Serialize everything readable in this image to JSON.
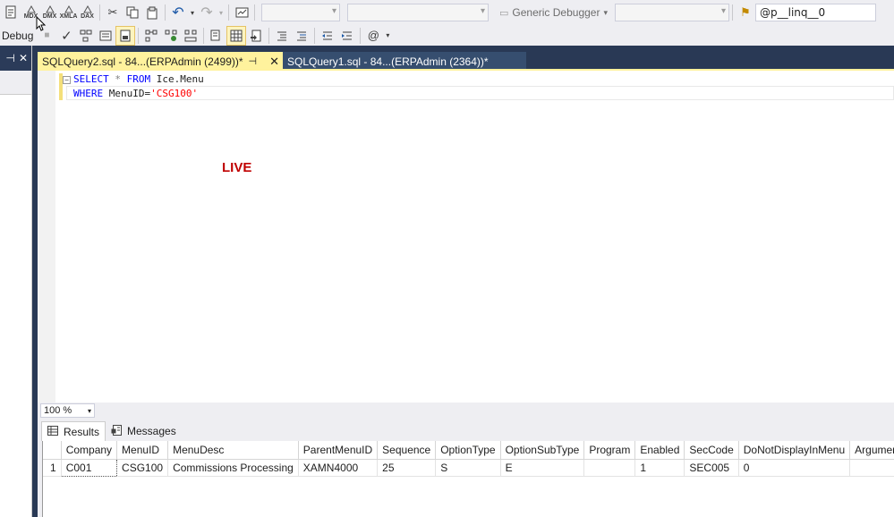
{
  "toolbar1": {
    "icons": [
      "new-query-icon",
      "mdx-icon",
      "dmx-icon",
      "xmla-icon",
      "dax-icon",
      "cut-icon",
      "copy-icon",
      "paste-icon",
      "undo-icon",
      "redo-icon",
      "screenshot-icon"
    ],
    "small_labels": {
      "mdx": "MDX",
      "dmx": "DMX",
      "xmla": "XMLA",
      "dax": "DAX"
    },
    "debugger_label": "Generic Debugger",
    "search_value": "@p__linq__0"
  },
  "toolbar2": {
    "debug_label": "Debug"
  },
  "leftpanel": {
    "pin": " ⊣",
    "close": "✕"
  },
  "tabs": [
    {
      "label": "SQLQuery2.sql - 84...(ERPAdmin (2499))*",
      "active": true
    },
    {
      "label": "SQLQuery1.sql - 84...(ERPAdmin (2364))*",
      "active": false
    }
  ],
  "editor": {
    "line1": {
      "kw1": "SELECT",
      "star": " * ",
      "kw2": "FROM",
      "rest": " Ice.Menu"
    },
    "line2": {
      "kw1": "WHERE",
      "rest": " MenuID=",
      "str": "'CSG100'"
    },
    "watermark": "LIVE"
  },
  "zoom": "100 %",
  "result_tabs": [
    {
      "label": "Results",
      "icon": "grid-icon"
    },
    {
      "label": "Messages",
      "icon": "messages-icon"
    }
  ],
  "grid": {
    "columns": [
      "Company",
      "MenuID",
      "MenuDesc",
      "ParentMenuID",
      "Sequence",
      "OptionType",
      "OptionSubType",
      "Program",
      "Enabled",
      "SecCode",
      "DoNotDisplayInMenu",
      "Arguments"
    ],
    "rows": [
      {
        "num": "1",
        "cells": [
          "C001",
          "CSG100",
          "Commissions Processing",
          "XAMN4000",
          "25",
          "S",
          "E",
          "",
          "1",
          "SEC005",
          "0",
          ""
        ]
      }
    ]
  }
}
